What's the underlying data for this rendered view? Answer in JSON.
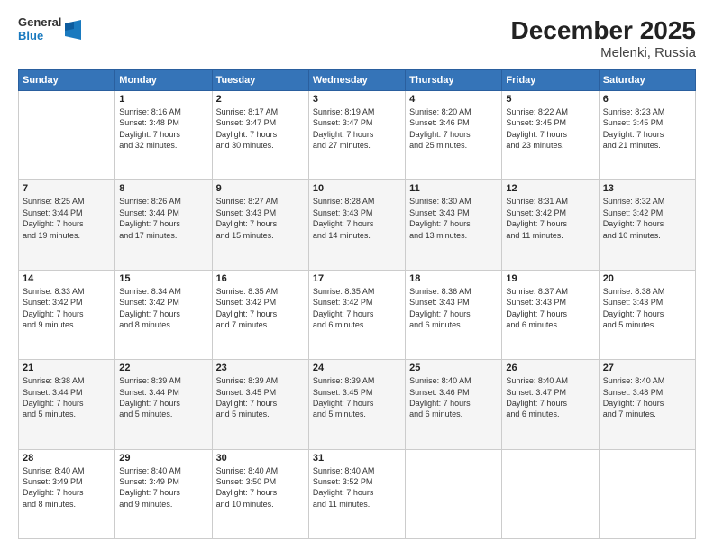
{
  "logo": {
    "line1": "General",
    "line2": "Blue"
  },
  "title": "December 2025",
  "subtitle": "Melenki, Russia",
  "days_of_week": [
    "Sunday",
    "Monday",
    "Tuesday",
    "Wednesday",
    "Thursday",
    "Friday",
    "Saturday"
  ],
  "weeks": [
    [
      {
        "day": "",
        "info": ""
      },
      {
        "day": "1",
        "info": "Sunrise: 8:16 AM\nSunset: 3:48 PM\nDaylight: 7 hours\nand 32 minutes."
      },
      {
        "day": "2",
        "info": "Sunrise: 8:17 AM\nSunset: 3:47 PM\nDaylight: 7 hours\nand 30 minutes."
      },
      {
        "day": "3",
        "info": "Sunrise: 8:19 AM\nSunset: 3:47 PM\nDaylight: 7 hours\nand 27 minutes."
      },
      {
        "day": "4",
        "info": "Sunrise: 8:20 AM\nSunset: 3:46 PM\nDaylight: 7 hours\nand 25 minutes."
      },
      {
        "day": "5",
        "info": "Sunrise: 8:22 AM\nSunset: 3:45 PM\nDaylight: 7 hours\nand 23 minutes."
      },
      {
        "day": "6",
        "info": "Sunrise: 8:23 AM\nSunset: 3:45 PM\nDaylight: 7 hours\nand 21 minutes."
      }
    ],
    [
      {
        "day": "7",
        "info": "Sunrise: 8:25 AM\nSunset: 3:44 PM\nDaylight: 7 hours\nand 19 minutes."
      },
      {
        "day": "8",
        "info": "Sunrise: 8:26 AM\nSunset: 3:44 PM\nDaylight: 7 hours\nand 17 minutes."
      },
      {
        "day": "9",
        "info": "Sunrise: 8:27 AM\nSunset: 3:43 PM\nDaylight: 7 hours\nand 15 minutes."
      },
      {
        "day": "10",
        "info": "Sunrise: 8:28 AM\nSunset: 3:43 PM\nDaylight: 7 hours\nand 14 minutes."
      },
      {
        "day": "11",
        "info": "Sunrise: 8:30 AM\nSunset: 3:43 PM\nDaylight: 7 hours\nand 13 minutes."
      },
      {
        "day": "12",
        "info": "Sunrise: 8:31 AM\nSunset: 3:42 PM\nDaylight: 7 hours\nand 11 minutes."
      },
      {
        "day": "13",
        "info": "Sunrise: 8:32 AM\nSunset: 3:42 PM\nDaylight: 7 hours\nand 10 minutes."
      }
    ],
    [
      {
        "day": "14",
        "info": "Sunrise: 8:33 AM\nSunset: 3:42 PM\nDaylight: 7 hours\nand 9 minutes."
      },
      {
        "day": "15",
        "info": "Sunrise: 8:34 AM\nSunset: 3:42 PM\nDaylight: 7 hours\nand 8 minutes."
      },
      {
        "day": "16",
        "info": "Sunrise: 8:35 AM\nSunset: 3:42 PM\nDaylight: 7 hours\nand 7 minutes."
      },
      {
        "day": "17",
        "info": "Sunrise: 8:35 AM\nSunset: 3:42 PM\nDaylight: 7 hours\nand 6 minutes."
      },
      {
        "day": "18",
        "info": "Sunrise: 8:36 AM\nSunset: 3:43 PM\nDaylight: 7 hours\nand 6 minutes."
      },
      {
        "day": "19",
        "info": "Sunrise: 8:37 AM\nSunset: 3:43 PM\nDaylight: 7 hours\nand 6 minutes."
      },
      {
        "day": "20",
        "info": "Sunrise: 8:38 AM\nSunset: 3:43 PM\nDaylight: 7 hours\nand 5 minutes."
      }
    ],
    [
      {
        "day": "21",
        "info": "Sunrise: 8:38 AM\nSunset: 3:44 PM\nDaylight: 7 hours\nand 5 minutes."
      },
      {
        "day": "22",
        "info": "Sunrise: 8:39 AM\nSunset: 3:44 PM\nDaylight: 7 hours\nand 5 minutes."
      },
      {
        "day": "23",
        "info": "Sunrise: 8:39 AM\nSunset: 3:45 PM\nDaylight: 7 hours\nand 5 minutes."
      },
      {
        "day": "24",
        "info": "Sunrise: 8:39 AM\nSunset: 3:45 PM\nDaylight: 7 hours\nand 5 minutes."
      },
      {
        "day": "25",
        "info": "Sunrise: 8:40 AM\nSunset: 3:46 PM\nDaylight: 7 hours\nand 6 minutes."
      },
      {
        "day": "26",
        "info": "Sunrise: 8:40 AM\nSunset: 3:47 PM\nDaylight: 7 hours\nand 6 minutes."
      },
      {
        "day": "27",
        "info": "Sunrise: 8:40 AM\nSunset: 3:48 PM\nDaylight: 7 hours\nand 7 minutes."
      }
    ],
    [
      {
        "day": "28",
        "info": "Sunrise: 8:40 AM\nSunset: 3:49 PM\nDaylight: 7 hours\nand 8 minutes."
      },
      {
        "day": "29",
        "info": "Sunrise: 8:40 AM\nSunset: 3:49 PM\nDaylight: 7 hours\nand 9 minutes."
      },
      {
        "day": "30",
        "info": "Sunrise: 8:40 AM\nSunset: 3:50 PM\nDaylight: 7 hours\nand 10 minutes."
      },
      {
        "day": "31",
        "info": "Sunrise: 8:40 AM\nSunset: 3:52 PM\nDaylight: 7 hours\nand 11 minutes."
      },
      {
        "day": "",
        "info": ""
      },
      {
        "day": "",
        "info": ""
      },
      {
        "day": "",
        "info": ""
      }
    ]
  ]
}
